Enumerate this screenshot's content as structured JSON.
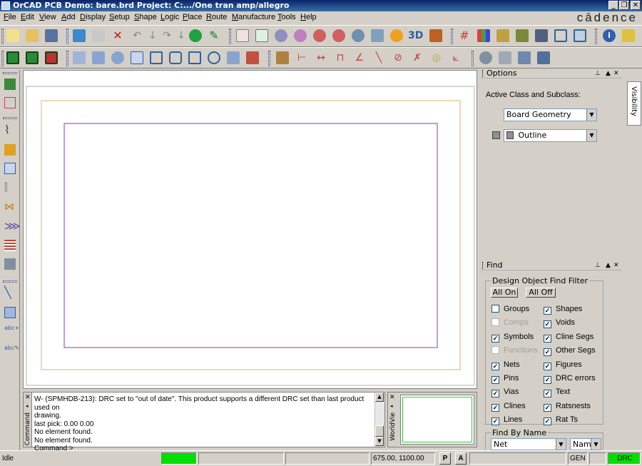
{
  "window": {
    "title": "OrCAD PCB Demo: bare.brd  Project: C:.../One tran amp/allegro",
    "brand": "cādence",
    "controls": {
      "minimize": "_",
      "restore": "❐",
      "close": "✕"
    }
  },
  "menu": [
    "File",
    "Edit",
    "View",
    "Add",
    "Display",
    "Setup",
    "Shape",
    "Logic",
    "Place",
    "Route",
    "Manufacture",
    "Tools",
    "Help"
  ],
  "options_panel": {
    "title": "Options",
    "active_class_label": "Active Class and Subclass:",
    "class_value": "Board Geometry",
    "subclass_value": "Outline",
    "visibility_tab": "Visibility"
  },
  "find_panel": {
    "title": "Find",
    "filter_group_label": "Design Object Find Filter",
    "all_on": "All On",
    "all_off": "All Off",
    "left_items": [
      {
        "label": "Groups",
        "checked": false,
        "enabled": true
      },
      {
        "label": "Comps",
        "checked": false,
        "enabled": false
      },
      {
        "label": "Symbols",
        "checked": true,
        "enabled": true
      },
      {
        "label": "Functions",
        "checked": false,
        "enabled": false
      },
      {
        "label": "Nets",
        "checked": true,
        "enabled": true
      },
      {
        "label": "Pins",
        "checked": true,
        "enabled": true
      },
      {
        "label": "Vias",
        "checked": true,
        "enabled": true
      },
      {
        "label": "Clines",
        "checked": true,
        "enabled": true
      },
      {
        "label": "Lines",
        "checked": true,
        "enabled": true
      }
    ],
    "right_items": [
      {
        "label": "Shapes",
        "checked": true
      },
      {
        "label": "Voids",
        "checked": true
      },
      {
        "label": "Cline Segs",
        "checked": true
      },
      {
        "label": "Other Segs",
        "checked": true
      },
      {
        "label": "Figures",
        "checked": true
      },
      {
        "label": "DRC errors",
        "checked": true
      },
      {
        "label": "Text",
        "checked": true
      },
      {
        "label": "Ratsnests",
        "checked": true
      },
      {
        "label": "Rat Ts",
        "checked": true
      }
    ],
    "find_by_name_label": "Find By Name",
    "find_type_value": "Net",
    "find_mode_value": "Name"
  },
  "command": {
    "tab_label": "Command",
    "lines": [
      "W- (SPMHDB-213): DRC set to \"out of date\". This product supports a different DRC set than last product used on",
      "drawing.",
      "last pick:  0.00  0.00",
      "No element found.",
      "No element found.",
      "Command >"
    ]
  },
  "worldview": {
    "tab_label": "WorldVie"
  },
  "status": {
    "state": "Idle",
    "coords": "675.00, 1100.00",
    "p_button": "P",
    "a_button": "A",
    "mode": "GEN",
    "drc": "DRC"
  },
  "colors": {
    "board_outline": "#e0b070",
    "design_outline": "#8a3ab8",
    "status_green": "#00e000"
  }
}
